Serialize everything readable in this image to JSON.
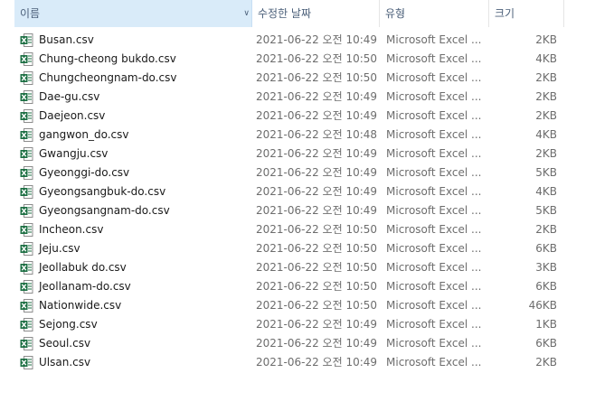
{
  "columns": {
    "name": "이름",
    "date": "수정한 날짜",
    "type": "유형",
    "size": "크기"
  },
  "files": [
    {
      "name": "Busan.csv",
      "date": "2021-06-22 오전 10:49",
      "type": "Microsoft Excel ...",
      "size": "2KB"
    },
    {
      "name": "Chung-cheong bukdo.csv",
      "date": "2021-06-22 오전 10:50",
      "type": "Microsoft Excel ...",
      "size": "4KB"
    },
    {
      "name": "Chungcheongnam-do.csv",
      "date": "2021-06-22 오전 10:50",
      "type": "Microsoft Excel ...",
      "size": "2KB"
    },
    {
      "name": "Dae-gu.csv",
      "date": "2021-06-22 오전 10:49",
      "type": "Microsoft Excel ...",
      "size": "2KB"
    },
    {
      "name": "Daejeon.csv",
      "date": "2021-06-22 오전 10:49",
      "type": "Microsoft Excel ...",
      "size": "2KB"
    },
    {
      "name": "gangwon_do.csv",
      "date": "2021-06-22 오전 10:48",
      "type": "Microsoft Excel ...",
      "size": "4KB"
    },
    {
      "name": "Gwangju.csv",
      "date": "2021-06-22 오전 10:49",
      "type": "Microsoft Excel ...",
      "size": "2KB"
    },
    {
      "name": "Gyeonggi-do.csv",
      "date": "2021-06-22 오전 10:49",
      "type": "Microsoft Excel ...",
      "size": "5KB"
    },
    {
      "name": "Gyeongsangbuk-do.csv",
      "date": "2021-06-22 오전 10:49",
      "type": "Microsoft Excel ...",
      "size": "4KB"
    },
    {
      "name": "Gyeongsangnam-do.csv",
      "date": "2021-06-22 오전 10:49",
      "type": "Microsoft Excel ...",
      "size": "5KB"
    },
    {
      "name": "Incheon.csv",
      "date": "2021-06-22 오전 10:50",
      "type": "Microsoft Excel ...",
      "size": "2KB"
    },
    {
      "name": "Jeju.csv",
      "date": "2021-06-22 오전 10:50",
      "type": "Microsoft Excel ...",
      "size": "6KB"
    },
    {
      "name": "Jeollabuk do.csv",
      "date": "2021-06-22 오전 10:50",
      "type": "Microsoft Excel ...",
      "size": "3KB"
    },
    {
      "name": "Jeollanam-do.csv",
      "date": "2021-06-22 오전 10:50",
      "type": "Microsoft Excel ...",
      "size": "6KB"
    },
    {
      "name": "Nationwide.csv",
      "date": "2021-06-22 오전 10:50",
      "type": "Microsoft Excel ...",
      "size": "46KB"
    },
    {
      "name": "Sejong.csv",
      "date": "2021-06-22 오전 10:49",
      "type": "Microsoft Excel ...",
      "size": "1KB"
    },
    {
      "name": "Seoul.csv",
      "date": "2021-06-22 오전 10:49",
      "type": "Microsoft Excel ...",
      "size": "6KB"
    },
    {
      "name": "Ulsan.csv",
      "date": "2021-06-22 오전 10:49",
      "type": "Microsoft Excel ...",
      "size": "2KB"
    }
  ],
  "icons": {
    "file": "excel-csv-file-icon",
    "sort": "sort-ascending-caret-icon",
    "dropdown": "column-dropdown-icon"
  },
  "colors": {
    "excel_green": "#1d7044",
    "header_selected": "#d9ebf9",
    "header_text": "#4c607a"
  }
}
